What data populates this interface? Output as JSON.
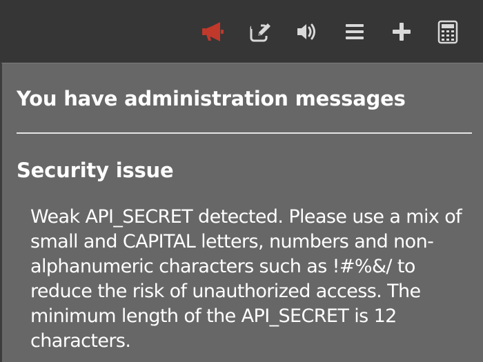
{
  "toolbar": {
    "icons": [
      {
        "name": "announcement-icon",
        "color": "#c0392b"
      },
      {
        "name": "edit-icon",
        "color": "#d9d9d9"
      },
      {
        "name": "volume-icon",
        "color": "#d9d9d9"
      },
      {
        "name": "menu-icon",
        "color": "#d9d9d9"
      },
      {
        "name": "add-icon",
        "color": "#d9d9d9"
      },
      {
        "name": "calculator-icon",
        "color": "#d9d9d9"
      }
    ]
  },
  "panel": {
    "title": "You have administration messages",
    "messages": [
      {
        "title": "Security issue",
        "body": "Weak API_SECRET detected. Please use a mix of small and CAPITAL letters, numbers and non-alphanumeric characters such as !#%&/ to reduce the risk of unauthorized access. The minimum length of the API_SECRET is 12 characters."
      }
    ]
  },
  "colors": {
    "topbar_bg": "#363636",
    "panel_bg": "#676767",
    "text": "#ffffff",
    "divider": "#e6e6e6",
    "accent_red": "#c0392b"
  }
}
